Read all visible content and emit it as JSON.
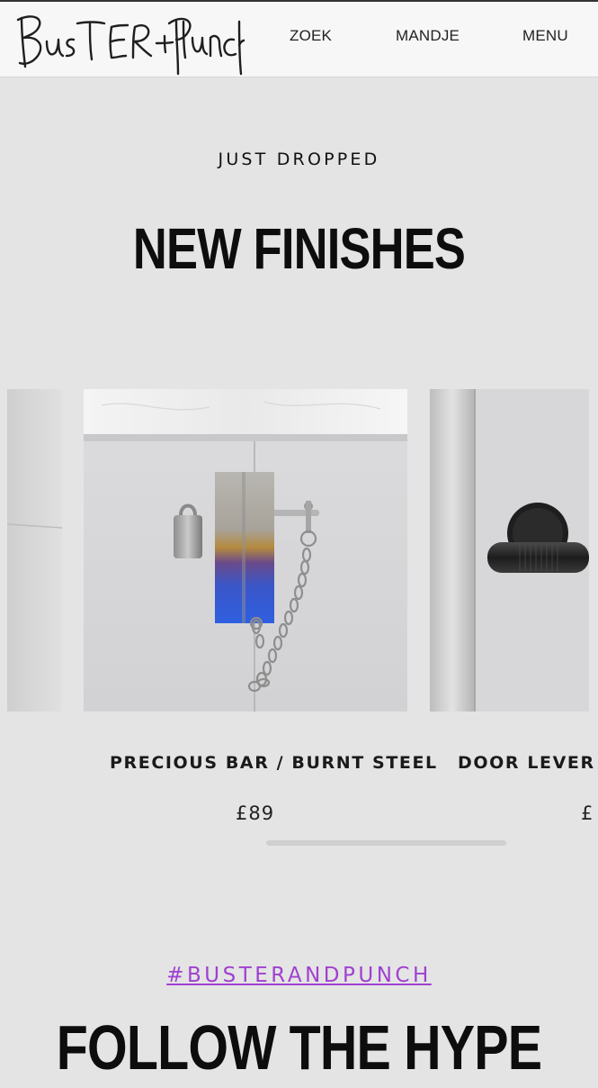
{
  "header": {
    "logo_text": "Buster+Punch",
    "nav": {
      "search": "ZOEK",
      "cart": "MANDJE",
      "menu": "MENU"
    }
  },
  "hero": {
    "eyebrow": "JUST DROPPED",
    "title": "NEW FINISHES"
  },
  "carousel": {
    "items": [
      {
        "title": "",
        "price": ""
      },
      {
        "title": "PRECIOUS BAR / BURNT STEEL",
        "price": "£89"
      },
      {
        "title": "DOOR LEVER H",
        "price": "£"
      }
    ]
  },
  "social": {
    "hashtag": "#BUSTERANDPUNCH",
    "title": "FOLLOW THE HYPE"
  },
  "colors": {
    "background": "#e4e4e4",
    "header_bg": "#f7f7f7",
    "hashtag": "#a040d0"
  }
}
